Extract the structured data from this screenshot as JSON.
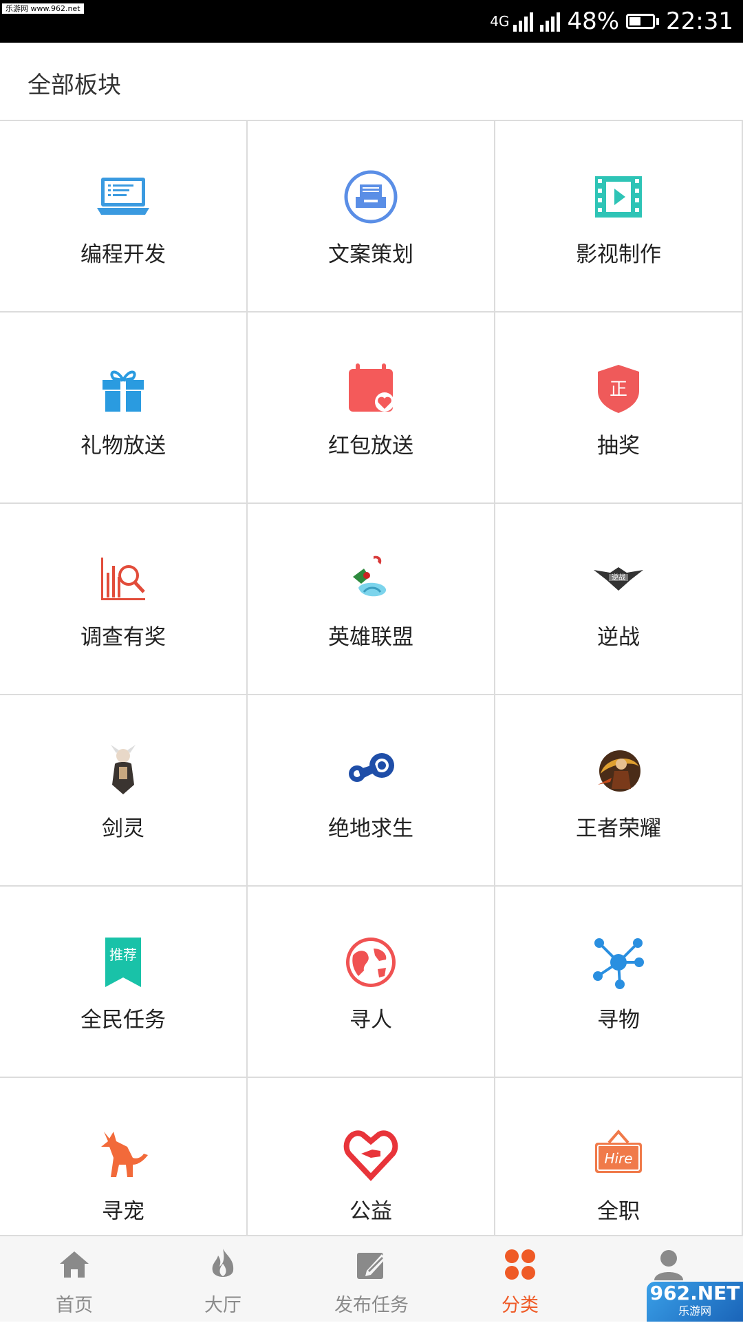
{
  "status_bar": {
    "watermark": "乐游网 www.962.net",
    "network": "4G",
    "battery": "48%",
    "time": "22:31"
  },
  "header": {
    "title": "全部板块"
  },
  "categories": [
    {
      "label": "编程开发",
      "icon": "laptop-icon",
      "color": "#3a9ae0"
    },
    {
      "label": "文案策划",
      "icon": "document-tray-icon",
      "color": "#5a8ee6"
    },
    {
      "label": "影视制作",
      "icon": "film-play-icon",
      "color": "#2ec4b6"
    },
    {
      "label": "礼物放送",
      "icon": "gift-icon",
      "color": "#2a9be0"
    },
    {
      "label": "红包放送",
      "icon": "calendar-heart-icon",
      "color": "#f45a5a"
    },
    {
      "label": "抽奖",
      "icon": "shield-zheng-icon",
      "color": "#ef5a5a"
    },
    {
      "label": "调查有奖",
      "icon": "chart-search-icon",
      "color": "#e24c3a"
    },
    {
      "label": "英雄联盟",
      "icon": "lol-game-icon",
      "color": "#3aa0c8"
    },
    {
      "label": "逆战",
      "icon": "nizhan-game-logo-icon",
      "color": "#444444"
    },
    {
      "label": "剑灵",
      "icon": "blade-soul-character-icon",
      "color": "#6a5a4a"
    },
    {
      "label": "绝地求生",
      "icon": "steam-logo-icon",
      "color": "#1f4ea8"
    },
    {
      "label": "王者荣耀",
      "icon": "honor-of-kings-hero-icon",
      "color": "#b0642a"
    },
    {
      "label": "全民任务",
      "icon": "recommend-bookmark-icon",
      "color": "#19c2a8",
      "icon_text": "推荐"
    },
    {
      "label": "寻人",
      "icon": "globe-icon",
      "color": "#f05252"
    },
    {
      "label": "寻物",
      "icon": "network-nodes-icon",
      "color": "#2a8fe0"
    },
    {
      "label": "寻宠",
      "icon": "pet-dog-icon",
      "color": "#f26a3a"
    },
    {
      "label": "公益",
      "icon": "heart-hand-icon",
      "color": "#e8343a"
    },
    {
      "label": "全职",
      "icon": "hire-sign-icon",
      "color": "#f07a4a",
      "icon_text": "Hire"
    }
  ],
  "nav": [
    {
      "label": "首页",
      "icon": "home-icon",
      "active": false
    },
    {
      "label": "大厅",
      "icon": "flame-icon",
      "active": false
    },
    {
      "label": "发布任务",
      "icon": "edit-pencil-icon",
      "active": false
    },
    {
      "label": "分类",
      "icon": "four-leaf-grid-icon",
      "active": true
    },
    {
      "label": "",
      "icon": "user-profile-icon",
      "active": false
    }
  ],
  "corner_watermark": {
    "main": "962.NET",
    "sub": "乐游网"
  },
  "colors": {
    "accent": "#ef5a26",
    "divider": "#dcdcdc",
    "inactive": "#8a8a8a"
  }
}
